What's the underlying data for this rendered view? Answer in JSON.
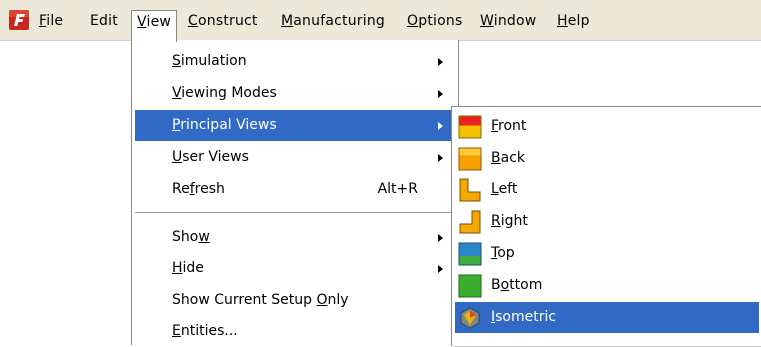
{
  "menubar": {
    "items": [
      {
        "pre": "",
        "u": "F",
        "post": "ile"
      },
      {
        "pre": "Edit",
        "u": "",
        "post": ""
      },
      {
        "pre": "",
        "u": "V",
        "post": "iew"
      },
      {
        "pre": "",
        "u": "C",
        "post": "onstruct"
      },
      {
        "pre": "",
        "u": "M",
        "post": "anufacturing"
      },
      {
        "pre": "",
        "u": "O",
        "post": "ptions"
      },
      {
        "pre": "",
        "u": "W",
        "post": "indow"
      },
      {
        "pre": "",
        "u": "H",
        "post": "elp"
      }
    ]
  },
  "view_menu": {
    "items": [
      {
        "pre": "",
        "u": "S",
        "post": "imulation",
        "shortcut": ""
      },
      {
        "pre": "",
        "u": "V",
        "post": "iewing Modes",
        "shortcut": ""
      },
      {
        "pre": "",
        "u": "P",
        "post": "rincipal Views",
        "shortcut": ""
      },
      {
        "pre": "",
        "u": "U",
        "post": "ser Views",
        "shortcut": ""
      },
      {
        "pre": "Re",
        "u": "f",
        "post": "resh",
        "shortcut": "Alt+R"
      },
      {
        "pre": "Sho",
        "u": "w",
        "post": "",
        "shortcut": ""
      },
      {
        "pre": "",
        "u": "H",
        "post": "ide",
        "shortcut": ""
      },
      {
        "pre": "Show Current Setup ",
        "u": "O",
        "post": "nly",
        "shortcut": ""
      },
      {
        "pre": "",
        "u": "E",
        "post": "ntities...",
        "shortcut": ""
      }
    ]
  },
  "principal_views": {
    "items": [
      {
        "pre": "",
        "u": "F",
        "post": "ront",
        "icon": "front-view-icon"
      },
      {
        "pre": "",
        "u": "B",
        "post": "ack",
        "icon": "back-view-icon"
      },
      {
        "pre": "",
        "u": "L",
        "post": "eft",
        "icon": "left-view-icon"
      },
      {
        "pre": "",
        "u": "R",
        "post": "ight",
        "icon": "right-view-icon"
      },
      {
        "pre": "",
        "u": "T",
        "post": "op",
        "icon": "top-view-icon"
      },
      {
        "pre": "B",
        "u": "o",
        "post": "ttom",
        "icon": "bottom-view-icon"
      },
      {
        "pre": "",
        "u": "I",
        "post": "sometric",
        "icon": "isometric-view-icon"
      }
    ]
  },
  "colors": {
    "menubar_bg": "#ece9d8",
    "highlight": "#316ac5",
    "app_icon_red": "#c8281e"
  }
}
